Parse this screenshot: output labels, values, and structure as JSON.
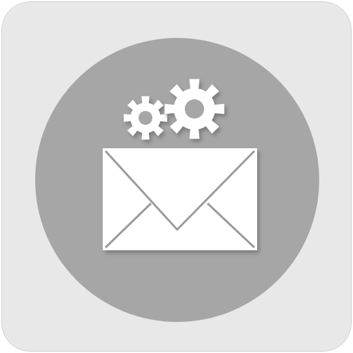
{
  "app_icon": {
    "name": "mail-settings",
    "colors": {
      "tile": "#e8e8e8",
      "tile_border": "#cfcfcf",
      "circle": "#a6a6a6",
      "glyph": "#ffffff",
      "envelope_line": "#9a9a9a",
      "shadow": "#6e6e6e"
    },
    "icons": [
      "envelope-icon",
      "gear-icon",
      "gear-icon"
    ]
  }
}
